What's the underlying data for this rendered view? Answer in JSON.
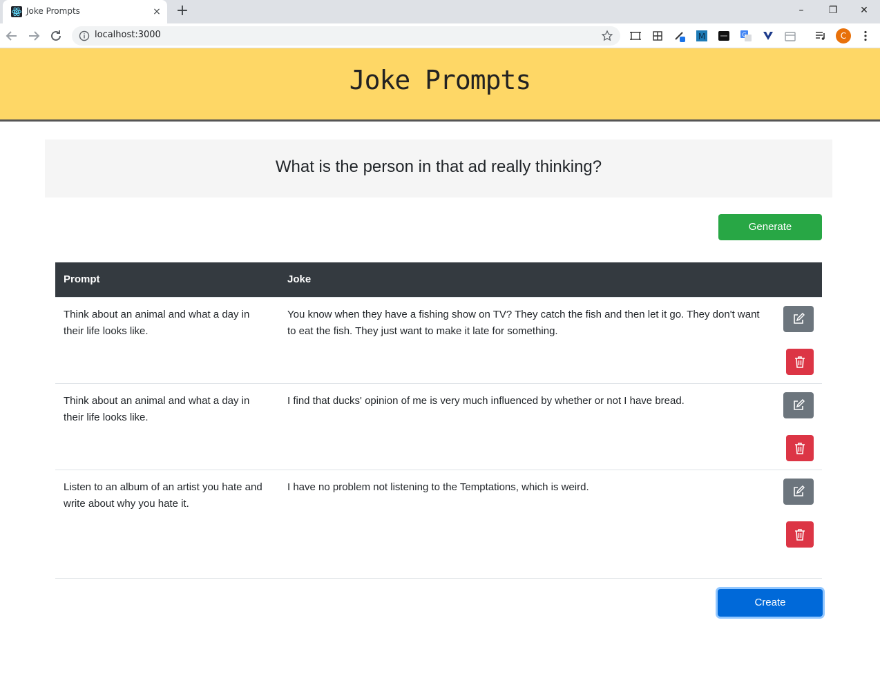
{
  "browser": {
    "tab_title": "Joke Prompts",
    "tab_close": "×",
    "new_tab": "+",
    "url": "localhost:3000",
    "window_controls": {
      "minimize": "–",
      "maximize": "❐",
      "close": "✕"
    },
    "profile_initial": "C"
  },
  "header": {
    "title": "Joke Prompts"
  },
  "prompt": {
    "current": "What is the person in that ad really thinking?"
  },
  "actions": {
    "generate_label": "Generate",
    "create_label": "Create"
  },
  "table": {
    "columns": [
      "Prompt",
      "Joke"
    ],
    "rows": [
      {
        "prompt": "Think about an animal and what a day in their life looks like.",
        "joke": "You know when they have a fishing show on TV? They catch the fish and then let it go. They don't want to eat the fish. They just want to make it late for something."
      },
      {
        "prompt": "Think about an animal and what a day in their life looks like.",
        "joke": "I find that ducks' opinion of me is very much influenced by whether or not I have bread."
      },
      {
        "prompt": "Listen to an album of an artist you hate and write about why you hate it.",
        "joke": "I have no problem not listening to the Temptations, which is weird."
      }
    ]
  },
  "colors": {
    "header_bg": "#fed766",
    "generate": "#28a745",
    "create": "#0069d9",
    "edit": "#6c757d",
    "delete": "#dc3545",
    "table_head": "#343a40"
  }
}
